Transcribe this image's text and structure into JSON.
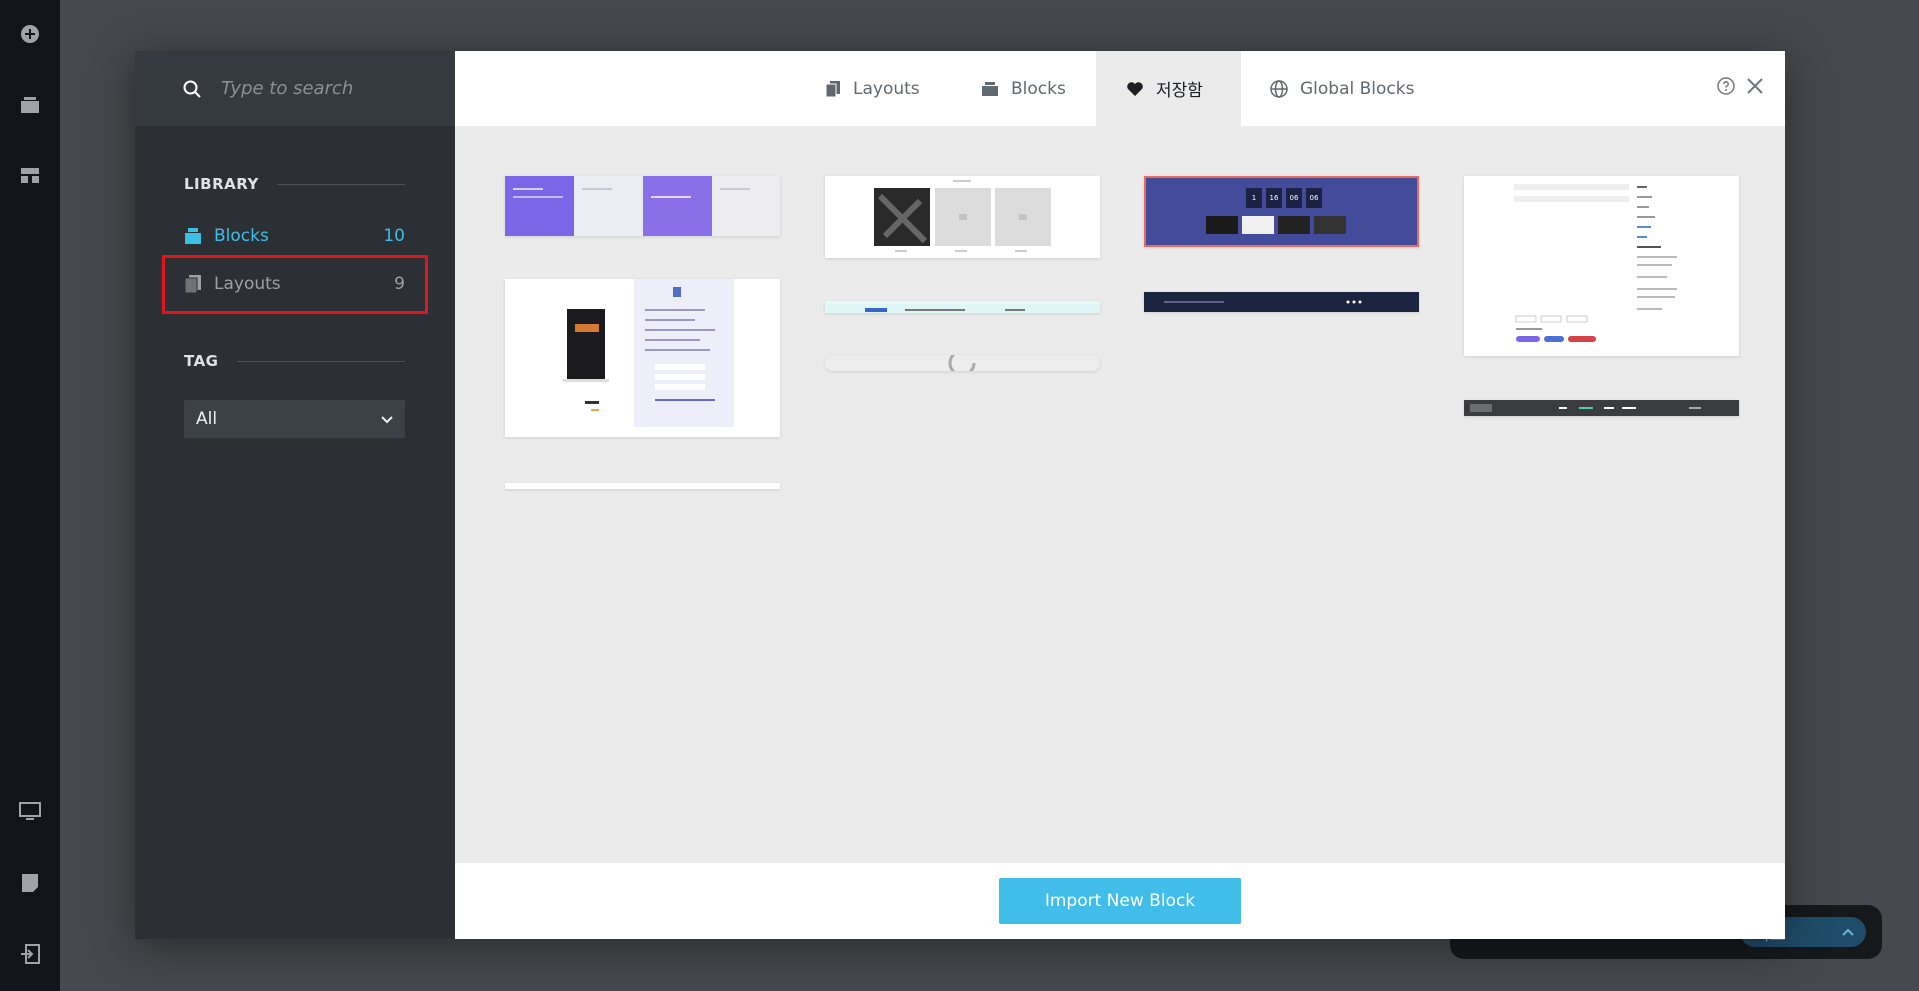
{
  "search": {
    "placeholder": "Type to search"
  },
  "library": {
    "title": "LIBRARY",
    "items": [
      {
        "label": "Blocks",
        "count": "10",
        "icon": "blocks-icon"
      },
      {
        "label": "Layouts",
        "count": "9",
        "icon": "layouts-icon"
      }
    ]
  },
  "tag": {
    "title": "TAG",
    "selected": "All"
  },
  "tabs": [
    {
      "label": "Layouts",
      "icon": "layouts-icon"
    },
    {
      "label": "Blocks",
      "icon": "blocks-icon"
    },
    {
      "label": "저장함",
      "icon": "heart-icon",
      "active": true
    },
    {
      "label": "Global Blocks",
      "icon": "globe-icon"
    }
  ],
  "footer": {
    "import_label": "Import New Block"
  },
  "editor_bar": {
    "save_label": "이트"
  },
  "countdown": [
    "1",
    "16",
    "06",
    "06"
  ],
  "colors": {
    "accent": "#40bde8",
    "highlight": "#e0161f",
    "sidebar": "#2c3035"
  }
}
